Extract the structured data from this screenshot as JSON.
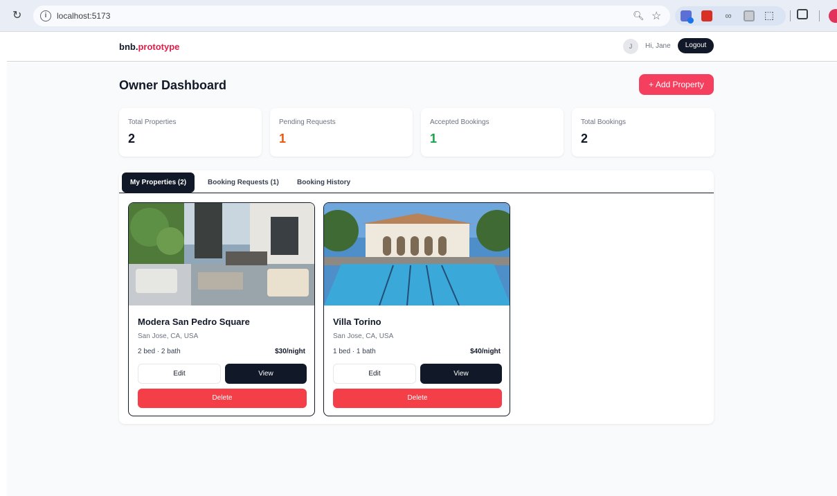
{
  "browser": {
    "url": "localhost:5173"
  },
  "header": {
    "brand_main": "bnb.",
    "brand_accent": "prototype",
    "avatar_initial": "J",
    "greeting": "Hi, Jane",
    "logout_label": "Logout"
  },
  "page": {
    "title": "Owner Dashboard",
    "add_property_label": "+ Add Property"
  },
  "stats": [
    {
      "label": "Total Properties",
      "value": "2",
      "color": "#111827"
    },
    {
      "label": "Pending Requests",
      "value": "1",
      "color": "#ea580c"
    },
    {
      "label": "Accepted Bookings",
      "value": "1",
      "color": "#16a34a"
    },
    {
      "label": "Total Bookings",
      "value": "2",
      "color": "#111827"
    }
  ],
  "tabs": [
    {
      "label": "My Properties (2)",
      "active": true
    },
    {
      "label": "Booking Requests (1)",
      "active": false
    },
    {
      "label": "Booking History",
      "active": false
    }
  ],
  "properties": [
    {
      "name": "Modera San Pedro Square",
      "location": "San Jose, CA, USA",
      "specs": "2 bed · 2 bath",
      "price": "$30/night",
      "edit_label": "Edit",
      "view_label": "View",
      "delete_label": "Delete"
    },
    {
      "name": "Villa Torino",
      "location": "San Jose, CA, USA",
      "specs": "1 bed · 1 bath",
      "price": "$40/night",
      "edit_label": "Edit",
      "view_label": "View",
      "delete_label": "Delete"
    }
  ],
  "colors": {
    "accent": "#f43f5e",
    "dark": "#111827",
    "delete": "#f43f48"
  }
}
